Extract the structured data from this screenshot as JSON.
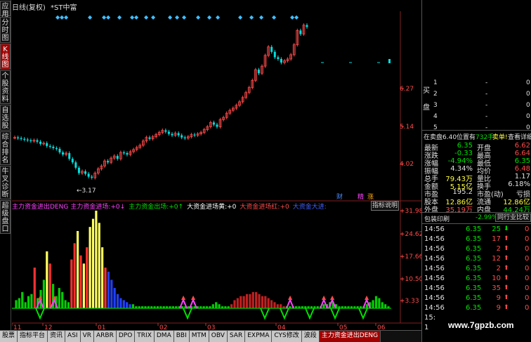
{
  "header": {
    "title": "日线(复权)",
    "stock": "*ST中富"
  },
  "sidebar": {
    "tabs": [
      "应用",
      "分时图",
      "K线图",
      "个股资料",
      "自选股",
      "综合排名",
      "牛叉诊断",
      "超级盘口"
    ],
    "active": 2
  },
  "price_axis": [
    "6.27",
    "5.14",
    "4.02"
  ],
  "indicator_axis": [
    "31.98",
    "24.62",
    "17.66",
    "10.50",
    "3.33"
  ],
  "min_label": "3.17",
  "x_labels": [
    "11",
    "12",
    "01",
    "02",
    "03",
    "04",
    "05",
    "06"
  ],
  "flags": {
    "cai": "财",
    "jing": "精",
    "zhang": "涨"
  },
  "formula": {
    "name": "主力资金进出DENG",
    "items": [
      {
        "label": "主力资金进场:",
        "value": "+0",
        "arrow": "↓",
        "color": "#ff40ff"
      },
      {
        "label": "主力资金出场:",
        "value": "+0",
        "arrow": "↑",
        "color": "#00e000"
      },
      {
        "label": "大资金进场黄:",
        "value": "+0",
        "color": "#ffffff"
      },
      {
        "label": "大资金进场红:",
        "value": "+0",
        "color": "#ff4a4a"
      },
      {
        "label": "大资金大进:",
        "value": "",
        "color": "#4060ff"
      }
    ],
    "help_button": "指标说明"
  },
  "bottom_tabs": [
    "股票",
    "指标平台",
    "资讯",
    "ASI",
    "VR",
    "ARBR",
    "DPO",
    "TRIX",
    "DMA",
    "BBI",
    "MTM",
    "OBV",
    "SAR",
    "EXPMA",
    "CYS修改",
    "波段",
    "主力资金进出DENG"
  ],
  "bottom_active": 16,
  "quote": {
    "buy_label": "买盘",
    "sell_label": "卖盘",
    "buy": [
      {
        "lvl": "1",
        "p": "-",
        "v": "0"
      },
      {
        "lvl": "2",
        "p": "-",
        "v": "0"
      },
      {
        "lvl": "3",
        "p": "-",
        "v": "0"
      },
      {
        "lvl": "4",
        "p": "-",
        "v": "0"
      },
      {
        "lvl": "5",
        "p": "-",
        "v": "0"
      }
    ],
    "status": "在卖盘6.40位置有",
    "status_vol": "732手",
    "sell_btn": "卖单!",
    "detail_btn": "查看详细",
    "stats": [
      {
        "l1": "最新",
        "v1": "6.35",
        "c1": "grn",
        "l2": "开盘",
        "v2": "6.62",
        "c2": "red"
      },
      {
        "l1": "涨跌",
        "v1": "-0.33",
        "c1": "grn",
        "l2": "最高",
        "v2": "6.64",
        "c2": "red"
      },
      {
        "l1": "涨幅",
        "v1": "-4.94%",
        "c1": "grn",
        "l2": "最低",
        "v2": "6.35",
        "c2": "grn"
      },
      {
        "l1": "振幅",
        "v1": "4.34%",
        "c1": "wht",
        "l2": "均价",
        "v2": "6.48",
        "c2": "red"
      },
      {
        "l1": "总手",
        "v1": "79.43万",
        "c1": "yel",
        "l2": "量比",
        "v2": "1.17",
        "c2": "wht"
      },
      {
        "l1": "金额",
        "v1": "5.15亿",
        "c1": "yel",
        "l2": "换手",
        "v2": "6.18%",
        "c2": "wht"
      },
      {
        "l1": "市盈",
        "v1": "195.2",
        "c1": "wht",
        "l2": "市盈(动)",
        "v2": "亏损",
        "c2": "wht"
      },
      {
        "l1": "股本",
        "v1": "12.86亿",
        "c1": "yel",
        "l2": "流通",
        "v2": "12.86亿",
        "c2": "yel"
      },
      {
        "l1": "外盘",
        "v1": "35.19万",
        "c1": "red",
        "l2": "内盘",
        "v2": "44.24万",
        "c2": "grn"
      }
    ],
    "sector": {
      "name": "包装印刷",
      "change": "-2.99%",
      "btn": "同行业比较"
    },
    "ticks": [
      {
        "t": "14:56",
        "p": "6.35",
        "v": "25",
        "d": "down"
      },
      {
        "t": "14:56",
        "p": "6.35",
        "v": "17",
        "d": "up"
      },
      {
        "t": "14:56",
        "p": "6.35",
        "v": "2",
        "d": "up"
      },
      {
        "t": "14:56",
        "p": "6.35",
        "v": "12",
        "d": "up"
      },
      {
        "t": "14:56",
        "p": "6.35",
        "v": "2",
        "d": "up"
      },
      {
        "t": "14:56",
        "p": "6.35",
        "v": "10",
        "d": "up"
      },
      {
        "t": "14:56",
        "p": "6.35",
        "v": "35",
        "d": "up"
      },
      {
        "t": "14:56",
        "p": "6.35",
        "v": "9",
        "d": "up"
      },
      {
        "t": "14:56",
        "p": "6.35",
        "v": "9",
        "d": "up"
      },
      {
        "t": "15:",
        "p": "",
        "v": "",
        "d": ""
      },
      {
        "t": "1",
        "p": "",
        "v": "",
        "d": ""
      }
    ]
  },
  "watermark": "www.7gpzb.com",
  "colors": {
    "up": "#ff4a4a",
    "down": "#00e0e0",
    "axis": "#c03030",
    "grid": "#802020"
  },
  "chart_data": {
    "type": "candlestick",
    "price_ticks": [
      6.27,
      5.14,
      4.02
    ],
    "closes": [
      4.3,
      4.28,
      4.26,
      4.24,
      4.22,
      4.2,
      4.22,
      4.18,
      4.12,
      4.14,
      4.06,
      4.04,
      4.0,
      3.98,
      3.88,
      3.82,
      3.86,
      3.7,
      3.6,
      3.45,
      3.3,
      3.35,
      3.28,
      3.2,
      3.17,
      3.3,
      3.42,
      3.5,
      3.64,
      3.6,
      3.72,
      3.78,
      3.7,
      3.88,
      3.86,
      3.82,
      3.9,
      3.96,
      4.02,
      4.08,
      4.2,
      4.3,
      4.26,
      4.32,
      4.38,
      4.44,
      4.5,
      4.46,
      4.4,
      4.36,
      4.42,
      4.36,
      4.3,
      4.28,
      4.32,
      4.38,
      4.36,
      4.4,
      4.44,
      4.52,
      4.6,
      4.72,
      4.66,
      4.6,
      4.8,
      4.86,
      4.98,
      5.06,
      5.12,
      5.2,
      5.3,
      5.42,
      5.56,
      5.7,
      5.9,
      6.2,
      6.1,
      6.3,
      6.6,
      6.84,
      6.7,
      6.55,
      6.5,
      6.4,
      6.45,
      6.5,
      6.62,
      6.9,
      7.3,
      7.2,
      7.45,
      7.4
    ],
    "indicator_bars": [
      4,
      5,
      8,
      3,
      6,
      7,
      20,
      5,
      9,
      14,
      28,
      22,
      12,
      6,
      10,
      8,
      4,
      3,
      24,
      32,
      38,
      26,
      22,
      30,
      40,
      44,
      48,
      42,
      30,
      20,
      18,
      14,
      10,
      7,
      5,
      4,
      3,
      2,
      2,
      1,
      1,
      1,
      1,
      1,
      1,
      1,
      1,
      1,
      1,
      1,
      1,
      1,
      1,
      1,
      1,
      1,
      1,
      1,
      1,
      1,
      1,
      1,
      1,
      1,
      2,
      3,
      2,
      1,
      1,
      1,
      2,
      4,
      5,
      6,
      6,
      7,
      7,
      8,
      8,
      7,
      6,
      6,
      5,
      4,
      3,
      2,
      2,
      1,
      1,
      1,
      1,
      1,
      1,
      1,
      1,
      1,
      1,
      1,
      1,
      1,
      2,
      2,
      3,
      3,
      2,
      1,
      1,
      1,
      1,
      1,
      1,
      1,
      1,
      1,
      2,
      3,
      4,
      6,
      5,
      3,
      2,
      1
    ]
  }
}
